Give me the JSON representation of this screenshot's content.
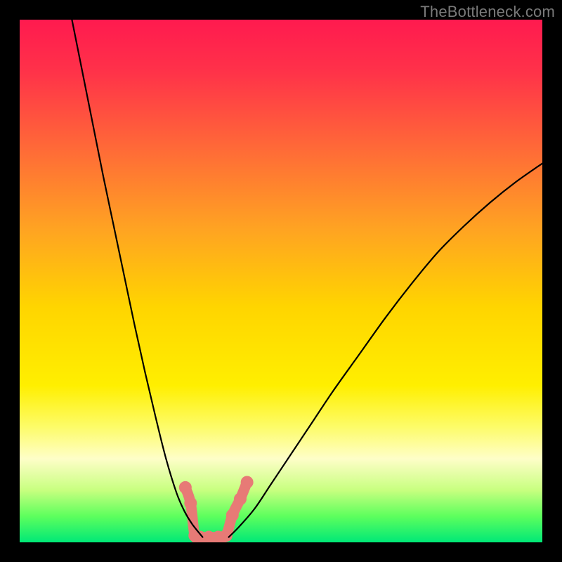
{
  "watermark": "TheBottleneck.com",
  "chart_data": {
    "type": "line",
    "title": "",
    "xlabel": "",
    "ylabel": "",
    "xlim": [
      0,
      100
    ],
    "ylim": [
      0,
      100
    ],
    "grid": false,
    "legend": false,
    "series": [
      {
        "name": "left-curve",
        "x": [
          10,
          12,
          14,
          16,
          18,
          20,
          22,
          24,
          26,
          28,
          30,
          31.5,
          33,
          35
        ],
        "y": [
          100,
          90,
          80,
          70,
          60.5,
          51,
          41.5,
          32.5,
          24,
          16,
          9.5,
          6,
          3.5,
          1
        ]
      },
      {
        "name": "right-curve",
        "x": [
          40,
          42,
          45,
          48,
          52,
          56,
          60,
          65,
          70,
          75,
          80,
          85,
          90,
          95,
          100
        ],
        "y": [
          1,
          3,
          6.5,
          11,
          17,
          23,
          29,
          36,
          43,
          49.5,
          55.5,
          60.5,
          65,
          69,
          72.5
        ]
      },
      {
        "name": "valley-trace",
        "marker": "circle",
        "x": [
          31.7,
          32.7,
          33.5,
          34.5,
          36.2,
          38.0,
          39.5,
          40.7,
          42.2,
          43.5
        ],
        "y": [
          10.5,
          7.5,
          1.3,
          1.0,
          1.0,
          1.0,
          1.3,
          5.2,
          8.3,
          11.5
        ]
      }
    ],
    "gradient_stops": [
      {
        "offset": 0.0,
        "color": "#ff1a4f"
      },
      {
        "offset": 0.1,
        "color": "#ff3249"
      },
      {
        "offset": 0.25,
        "color": "#ff6b37"
      },
      {
        "offset": 0.4,
        "color": "#ffa322"
      },
      {
        "offset": 0.55,
        "color": "#ffd500"
      },
      {
        "offset": 0.7,
        "color": "#ffef00"
      },
      {
        "offset": 0.78,
        "color": "#fdfc6a"
      },
      {
        "offset": 0.84,
        "color": "#fefec8"
      },
      {
        "offset": 0.9,
        "color": "#c8ff80"
      },
      {
        "offset": 0.95,
        "color": "#5dff5d"
      },
      {
        "offset": 1.0,
        "color": "#00e877"
      }
    ],
    "marker_style": {
      "fill": "#e77a76",
      "stroke": "#e77a76",
      "radius": 9
    },
    "trace_line_style": {
      "stroke": "#e77a76",
      "width": 15
    },
    "curve_line_style": {
      "stroke": "#000000",
      "width": 2.2
    }
  }
}
